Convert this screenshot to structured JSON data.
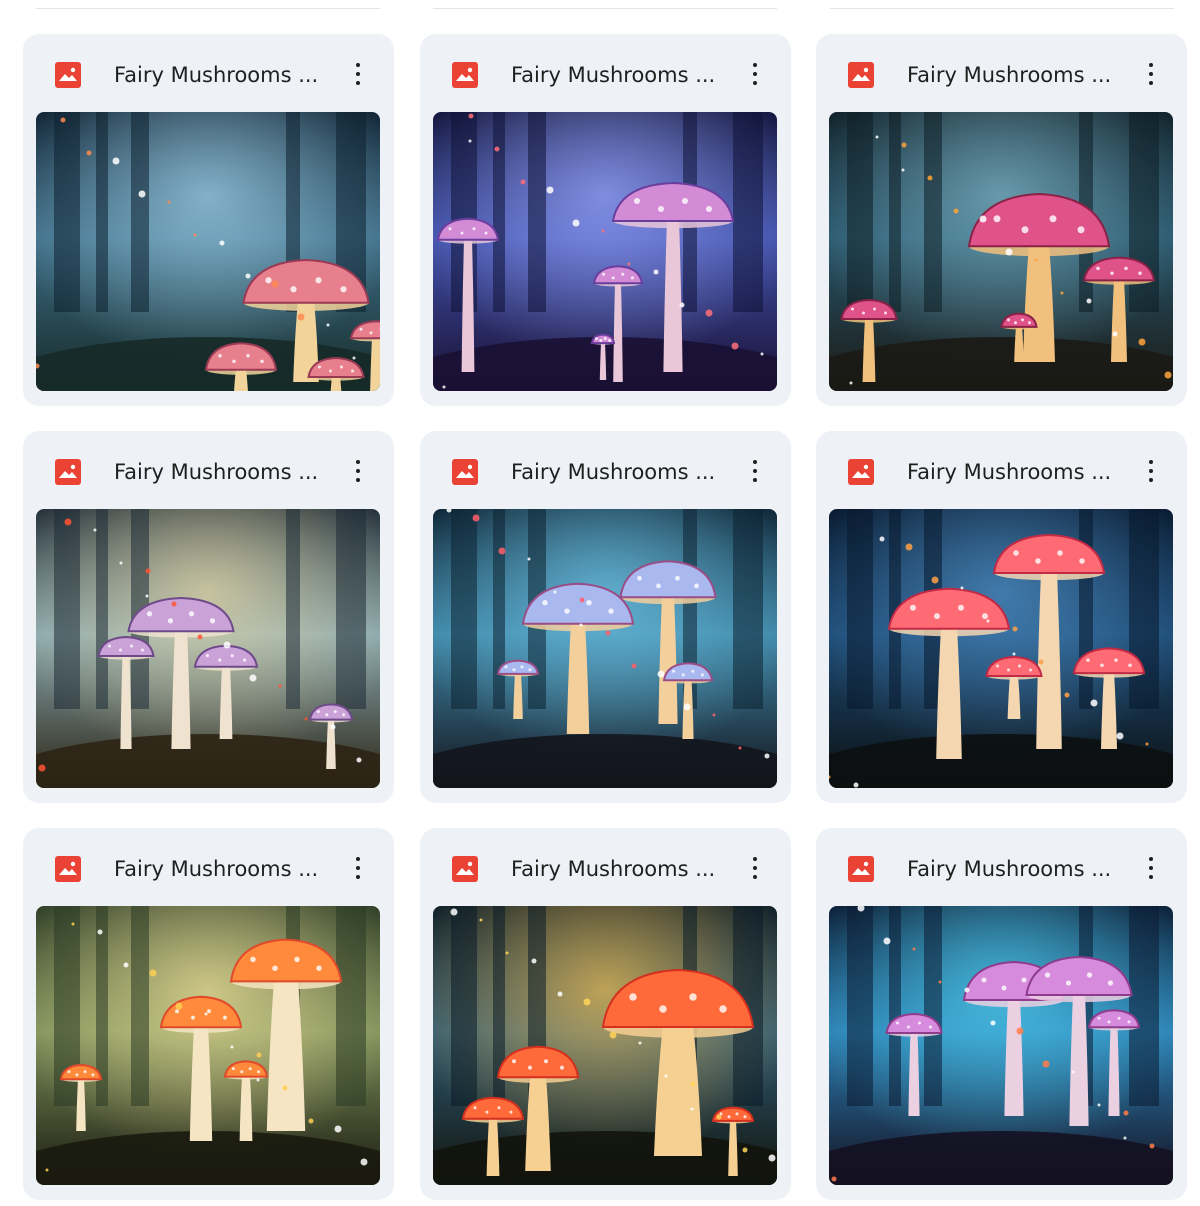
{
  "files": [
    {
      "name": "Fairy Mushrooms ...",
      "icon": "image-file-icon",
      "thumb": "purple-forest-glowing-mushrooms"
    },
    {
      "name": "Fairy Mushrooms ...",
      "icon": "image-file-icon",
      "thumb": "blue-night-forest-mushrooms"
    },
    {
      "name": "Fairy Mushrooms ...",
      "icon": "image-file-icon",
      "thumb": "pink-mushroom-bokeh"
    },
    {
      "name": "Fairy Mushrooms ...",
      "icon": "image-file-icon",
      "thumb": "misty-forest-lilac-mushrooms"
    },
    {
      "name": "Fairy Mushrooms ...",
      "icon": "image-file-icon",
      "thumb": "blue-forest-glowing-caps"
    },
    {
      "name": "Fairy Mushrooms ...",
      "icon": "image-file-icon",
      "thumb": "red-spotted-mushrooms-blue-night"
    },
    {
      "name": "Fairy Mushrooms ...",
      "icon": "image-file-icon",
      "thumb": "orange-mushrooms-moss"
    },
    {
      "name": "Fairy Mushrooms ...",
      "icon": "image-file-icon",
      "thumb": "red-toadstool-bokeh"
    },
    {
      "name": "Fairy Mushrooms ...",
      "icon": "image-file-icon",
      "thumb": "violet-mushrooms-blue-glow"
    }
  ],
  "colors": {
    "card_bg": "#eef1f6",
    "icon_red": "#ea4335",
    "title_text": "#1f1f1f"
  }
}
